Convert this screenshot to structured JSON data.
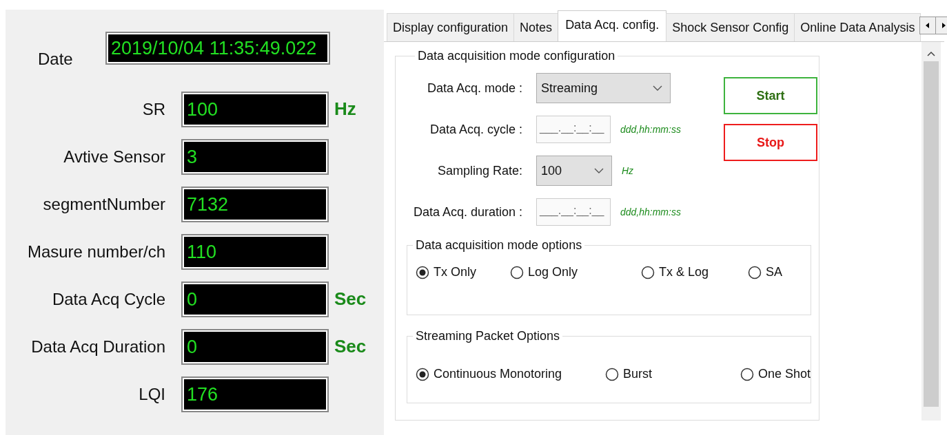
{
  "readout_panel": {
    "fields": [
      {
        "kind": "wide",
        "label": "Date",
        "value": "2019/10/04 11:35:49.022"
      },
      {
        "kind": "normal",
        "label": "SR",
        "value": "100",
        "unit": "Hz"
      },
      {
        "kind": "normal",
        "label": "Avtive Sensor",
        "value": "3"
      },
      {
        "kind": "normal",
        "label": "segmentNumber",
        "value": "7132"
      },
      {
        "kind": "normal",
        "label": "Masure number/ch",
        "value": "110"
      },
      {
        "kind": "normal",
        "label": "Data Acq Cycle",
        "value": "0",
        "unit": "Sec"
      },
      {
        "kind": "normal",
        "label": "Data Acq Duration",
        "value": "0",
        "unit": "Sec"
      },
      {
        "kind": "normal",
        "label": "LQI",
        "value": "176"
      }
    ]
  },
  "config_panel": {
    "tabs": [
      {
        "label": "Display configuration",
        "selected": false
      },
      {
        "label": "Notes",
        "selected": false
      },
      {
        "label": "Data Acq. config.",
        "selected": true
      },
      {
        "label": "Shock Sensor Config",
        "selected": false
      },
      {
        "label": "Online Data Analysis",
        "selected": false
      }
    ],
    "group_title": "Data acquisition mode configuration",
    "settings": [
      {
        "kind": "dropdown",
        "label": "Data Acq. mode :",
        "value": "Streaming"
      },
      {
        "kind": "masked",
        "label": "Data Acq. cycle :",
        "value": "___.__:__:__",
        "hint": "ddd,hh:mm:ss"
      },
      {
        "kind": "dropdown_small",
        "label": "Sampling Rate:",
        "value": "100",
        "hint": "Hz"
      },
      {
        "kind": "masked",
        "label": "Data Acq. duration :",
        "value": "___.__:__:__",
        "hint": "ddd,hh:mm:ss"
      }
    ],
    "buttons": [
      {
        "kind": "start",
        "label": "Start"
      },
      {
        "kind": "stop",
        "label": "Stop"
      }
    ],
    "option_groups": [
      {
        "title": "Data acquisition mode options",
        "options": [
          {
            "label": "Tx Only",
            "selected": true
          },
          {
            "label": "Log Only",
            "selected": false
          },
          {
            "label": "Tx & Log",
            "selected": false
          },
          {
            "label": "SA",
            "selected": false
          }
        ]
      },
      {
        "title": "Streaming Packet Options",
        "options": [
          {
            "label": "Continuous Monotoring",
            "selected": true
          },
          {
            "label": "Burst",
            "selected": false
          },
          {
            "label": "One Shot",
            "selected": false
          }
        ]
      }
    ]
  }
}
